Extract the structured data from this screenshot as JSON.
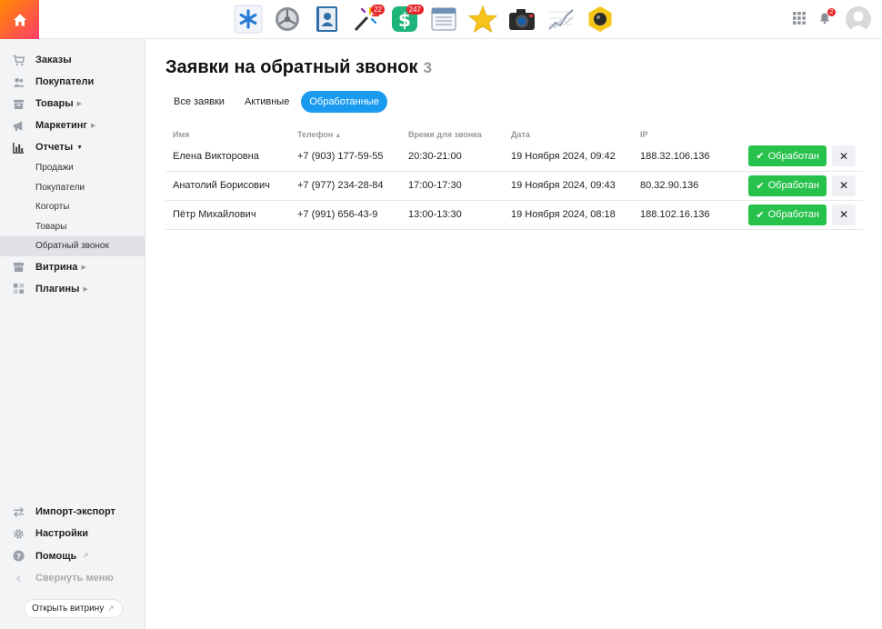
{
  "topbar": {
    "apps": [
      {
        "name": "asterisk-app",
        "badge": ""
      },
      {
        "name": "settings-app",
        "badge": ""
      },
      {
        "name": "contacts-app",
        "badge": ""
      },
      {
        "name": "magic-wand-app",
        "badge": "22"
      },
      {
        "name": "money-app",
        "badge": "247"
      },
      {
        "name": "browser-app",
        "badge": ""
      },
      {
        "name": "star-app",
        "badge": ""
      },
      {
        "name": "camera-app",
        "badge": ""
      },
      {
        "name": "chart-app",
        "badge": ""
      },
      {
        "name": "hexagon-app",
        "badge": ""
      }
    ],
    "notifications_count": "2"
  },
  "sidebar": {
    "items": [
      {
        "label": "Заказы",
        "icon": "cart-icon"
      },
      {
        "label": "Покупатели",
        "icon": "users-icon"
      },
      {
        "label": "Товары",
        "icon": "box-icon"
      },
      {
        "label": "Маркетинг",
        "icon": "megaphone-icon"
      },
      {
        "label": "Отчеты",
        "icon": "bar-chart-icon"
      }
    ],
    "subitems": [
      "Продажи",
      "Покупатели",
      "Когорты",
      "Товары",
      "Обратный звонок"
    ],
    "items_after": [
      {
        "label": "Витрина",
        "icon": "storefront-icon"
      },
      {
        "label": "Плагины",
        "icon": "plugins-icon"
      }
    ],
    "bottom": [
      {
        "label": "Импорт-экспорт",
        "icon": "arrows-icon"
      },
      {
        "label": "Настройки",
        "icon": "gear-icon"
      },
      {
        "label": "Помощь",
        "icon": "help-icon"
      },
      {
        "label": "Свернуть меню",
        "icon": "collapse-icon"
      }
    ],
    "open_store_label": "Открыть витрину"
  },
  "main": {
    "title": "Заявки на обратный звонок",
    "count": "3",
    "tabs": [
      "Все заявки",
      "Активные",
      "Обработанные"
    ],
    "active_tab": 2,
    "columns": [
      "Имя",
      "Телефон",
      "Время для звонка",
      "Дата",
      "IP"
    ],
    "rows": [
      {
        "name": "Елена Викторовна",
        "phone": "+7 (903) 177-59-55",
        "time": "20:30-21:00",
        "date": "19 Ноября 2024, 09:42",
        "ip": "188.32.106.136"
      },
      {
        "name": "Анатолий Борисович",
        "phone": "+7 (977) 234-28-84",
        "time": "17:00-17:30",
        "date": "19 Ноября 2024, 09:43",
        "ip": "80.32.90.136"
      },
      {
        "name": "Пётр Михайлович",
        "phone": "+7 (991) 656-43-9",
        "time": "13:00-13:30",
        "date": "19 Ноября 2024, 08:18",
        "ip": "188.102.16.136"
      }
    ],
    "done_label": "Обработан",
    "colors": {
      "accent": "#1a9bf0",
      "success": "#27c24c",
      "home_gradient_start": "#ff8a00",
      "home_gradient_end": "#ff3d6b"
    }
  }
}
